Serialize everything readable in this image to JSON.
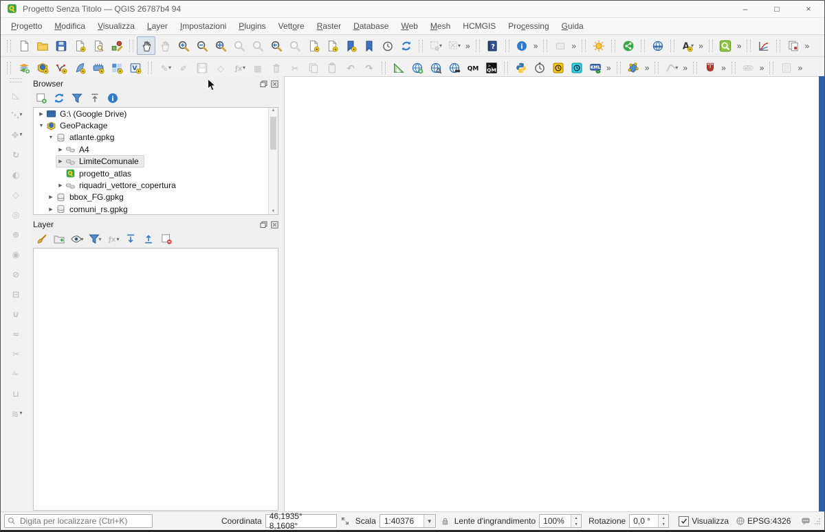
{
  "window": {
    "title": "Progetto Senza Titolo — QGIS 26787b4 94",
    "controls": {
      "minimize": "–",
      "maximize": "□",
      "close": "×"
    }
  },
  "menu": {
    "items": [
      {
        "label": "Progetto",
        "accel": 0
      },
      {
        "label": "Modifica",
        "accel": 0
      },
      {
        "label": "Visualizza",
        "accel": 0
      },
      {
        "label": "Layer",
        "accel": 0
      },
      {
        "label": "Impostazioni",
        "accel": 0
      },
      {
        "label": "Plugins",
        "accel": 0
      },
      {
        "label": "Vettore",
        "accel": 4
      },
      {
        "label": "Raster",
        "accel": 0
      },
      {
        "label": "Database",
        "accel": 0
      },
      {
        "label": "Web",
        "accel": 0
      },
      {
        "label": "Mesh",
        "accel": 0
      },
      {
        "label": "HCMGIS",
        "accel": -1
      },
      {
        "label": "Processing",
        "accel": 3
      },
      {
        "label": "Guida",
        "accel": 0
      }
    ]
  },
  "toolbar_row1": [
    {
      "sep": 1
    },
    {
      "n": "project-new",
      "k": "page"
    },
    {
      "n": "project-open",
      "k": "folder"
    },
    {
      "n": "project-save",
      "k": "floppy"
    },
    {
      "n": "new-print-layout",
      "k": "pagebadge"
    },
    {
      "n": "show-layout-manager",
      "k": "layoutmgr"
    },
    {
      "n": "style-manager",
      "k": "styles"
    },
    {
      "sep": 1
    },
    {
      "n": "pan-map",
      "k": "hand",
      "s": "active"
    },
    {
      "n": "pan-to-selection",
      "k": "handgray",
      "s": "disabled"
    },
    {
      "n": "zoom-in",
      "k": "magp"
    },
    {
      "n": "zoom-out",
      "k": "magm"
    },
    {
      "n": "zoom-full-extent",
      "k": "magfull"
    },
    {
      "n": "zoom-to-selection",
      "k": "maggray",
      "s": "disabled"
    },
    {
      "n": "zoom-to-layer",
      "k": "maggray",
      "s": "disabled"
    },
    {
      "n": "zoom-last",
      "k": "maglast"
    },
    {
      "n": "zoom-next",
      "k": "magnext",
      "s": "disabled"
    },
    {
      "n": "new-map-view",
      "k": "pagebadge"
    },
    {
      "n": "new-3d-map-view",
      "k": "pagebadge"
    },
    {
      "n": "new-spatial-bookmark",
      "k": "bmbadge"
    },
    {
      "n": "show-spatial-bookmarks",
      "k": "bookmark"
    },
    {
      "n": "temporal-controller",
      "k": "clock"
    },
    {
      "n": "refresh-map",
      "k": "refresh"
    },
    {
      "sep": 1
    },
    {
      "n": "select-features",
      "k": "selgray",
      "s": "disabled",
      "dd": 1
    },
    {
      "n": "deselect-features",
      "k": "deselgray",
      "s": "disabled",
      "dd": 1
    },
    {
      "ovf": 1
    },
    {
      "sep": 1
    },
    {
      "n": "help-contents",
      "k": "book"
    },
    {
      "sep": 1
    },
    {
      "n": "identify-info",
      "k": "info"
    },
    {
      "ovf": 1
    },
    {
      "sep": 1
    },
    {
      "n": "plugin-tool-disabled",
      "k": "gray1",
      "s": "disabled"
    },
    {
      "ovf": 1
    },
    {
      "sep": 1
    },
    {
      "n": "plugin-sun",
      "k": "sun"
    },
    {
      "sep": 1
    },
    {
      "n": "plugin-share",
      "k": "share"
    },
    {
      "sep": 1
    },
    {
      "n": "plugin-web-globe",
      "k": "globe"
    },
    {
      "sep": 1
    },
    {
      "n": "auto-label",
      "k": "labelA",
      "dd": 1
    },
    {
      "ovf": 1
    },
    {
      "sep": 1
    },
    {
      "n": "plugin-zoom-level",
      "k": "greenzoom"
    },
    {
      "ovf": 1
    },
    {
      "sep": 1
    },
    {
      "n": "plugin-profile-chart",
      "k": "chart"
    },
    {
      "sep": 1
    },
    {
      "n": "plugin-document-copy",
      "k": "doccopy"
    },
    {
      "ovf": 1
    }
  ],
  "toolbar_row2": [
    {
      "sep": 1
    },
    {
      "n": "data-source-manager",
      "k": "dsm"
    },
    {
      "n": "new-geopackage-layer",
      "k": "boxglobe"
    },
    {
      "n": "new-shapefile-layer",
      "k": "vnode"
    },
    {
      "n": "new-spatialite-layer",
      "k": "quill"
    },
    {
      "n": "new-temporary-scratch-layer",
      "k": "comb"
    },
    {
      "n": "new-mesh-layer",
      "k": "gridb"
    },
    {
      "n": "new-virtual-layer",
      "k": "vbox"
    },
    {
      "sep": 1
    },
    {
      "n": "current-edits",
      "k": "pengray",
      "s": "disabled",
      "dd": 1
    },
    {
      "n": "toggle-editing",
      "k": "pen2gray",
      "s": "disabled"
    },
    {
      "n": "save-layer-edits",
      "k": "floppygray",
      "s": "disabled"
    },
    {
      "n": "add-feature",
      "k": "polygray",
      "s": "disabled"
    },
    {
      "n": "field-calculator",
      "k": "fxgray",
      "s": "disabled",
      "dd": 1
    },
    {
      "n": "multiedit-attributes",
      "k": "tablegray",
      "s": "disabled"
    },
    {
      "n": "delete-selected",
      "k": "trash",
      "s": "disabled"
    },
    {
      "n": "cut-features",
      "k": "cut",
      "s": "disabled"
    },
    {
      "n": "copy-features",
      "k": "copygray",
      "s": "disabled"
    },
    {
      "n": "paste-features",
      "k": "paste",
      "s": "disabled"
    },
    {
      "n": "undo",
      "k": "undo",
      "s": "disabled"
    },
    {
      "n": "redo",
      "k": "redo",
      "s": "disabled"
    },
    {
      "sep": 1
    },
    {
      "n": "plugin-set-square",
      "k": "setsquare"
    },
    {
      "n": "plugin-globe-add",
      "k": "globeplus"
    },
    {
      "n": "plugin-globe-search",
      "k": "globemag"
    },
    {
      "n": "plugin-globe-binoculars",
      "k": "globebinoc"
    },
    {
      "n": "quickmapservices",
      "k": "qm"
    },
    {
      "n": "qms-search",
      "k": "qmb"
    },
    {
      "sep": 1
    },
    {
      "n": "python-console",
      "k": "python"
    },
    {
      "n": "plugin-stopwatch",
      "k": "stopwatch"
    },
    {
      "n": "plugin-time-manager",
      "k": "tyellow"
    },
    {
      "n": "plugin-temporal-cyan",
      "k": "tcyan"
    },
    {
      "n": "plugin-kml-tools",
      "k": "kml"
    },
    {
      "ovf": 1
    },
    {
      "sep": 1
    },
    {
      "n": "plugin-vertex-tool",
      "k": "vertexblue"
    },
    {
      "ovf": 1
    },
    {
      "sep": 1
    },
    {
      "n": "digitize-curve",
      "k": "curvegray",
      "s": "disabled",
      "dd": 1
    },
    {
      "ovf": 1
    },
    {
      "sep": 1
    },
    {
      "n": "snapping-toggle",
      "k": "magnet"
    },
    {
      "ovf": 1
    },
    {
      "sep": 1
    },
    {
      "n": "label-abc",
      "k": "abcgray",
      "s": "disabled"
    },
    {
      "ovf": 1
    },
    {
      "sep": 1
    },
    {
      "n": "layer-notes",
      "k": "notesgray",
      "s": "disabled"
    },
    {
      "ovf": 1
    }
  ],
  "left_toolbar": [
    {
      "handle": 1
    },
    {
      "n": "interpolate-point",
      "k": "g",
      "c": "◺"
    },
    {
      "n": "measure-segment",
      "k": "g",
      "c": "⋱",
      "dd": 1
    },
    {
      "n": "move-feature",
      "k": "g",
      "c": "✥",
      "dd": 1
    },
    {
      "n": "copy-move-feature",
      "k": "g",
      "c": "↻"
    },
    {
      "n": "rotate-feature",
      "k": "g",
      "c": "◐"
    },
    {
      "n": "simplify-feature",
      "k": "g",
      "c": "◇"
    },
    {
      "n": "add-ring",
      "k": "g",
      "c": "◎"
    },
    {
      "n": "add-part",
      "k": "g",
      "c": "⊕"
    },
    {
      "n": "fill-ring",
      "k": "g",
      "c": "◉"
    },
    {
      "n": "delete-ring",
      "k": "g",
      "c": "⊘"
    },
    {
      "n": "delete-part",
      "k": "g",
      "c": "⊟"
    },
    {
      "n": "offset-curve",
      "k": "g",
      "c": "∪"
    },
    {
      "n": "reshape-features",
      "k": "g",
      "c": "≈"
    },
    {
      "n": "split-features",
      "k": "g",
      "c": "✂"
    },
    {
      "n": "split-parts",
      "k": "g",
      "c": "✁"
    },
    {
      "n": "merge-features",
      "k": "g",
      "c": "⊔"
    },
    {
      "n": "trim-extend",
      "k": "g",
      "c": "≋",
      "dd": 1
    }
  ],
  "browser_panel": {
    "title": "Browser",
    "toolbar": [
      {
        "n": "add-selected-layers",
        "k": "boxplus"
      },
      {
        "n": "refresh-browser",
        "k": "refresh"
      },
      {
        "n": "filter-browser",
        "k": "funnel"
      },
      {
        "n": "collapse-all",
        "k": "collapseg"
      },
      {
        "n": "browser-properties",
        "k": "info"
      }
    ],
    "tree": [
      {
        "label": "G:\\ (Google Drive)",
        "depth": 0,
        "expand": "closed",
        "icon": "drive"
      },
      {
        "label": "GeoPackage",
        "depth": 0,
        "expand": "open",
        "icon": "gpkg"
      },
      {
        "label": "atlante.gpkg",
        "depth": 1,
        "expand": "open",
        "icon": "db"
      },
      {
        "label": "A4",
        "depth": 2,
        "expand": "closed",
        "icon": "poly"
      },
      {
        "label": "LimiteComunale",
        "depth": 2,
        "expand": "closed",
        "icon": "poly",
        "selected": true
      },
      {
        "label": "progetto_atlas",
        "depth": 2,
        "expand": "none",
        "icon": "qgis"
      },
      {
        "label": "riquadri_vettore_copertura",
        "depth": 2,
        "expand": "closed",
        "icon": "poly"
      },
      {
        "label": "bbox_FG.gpkg",
        "depth": 1,
        "expand": "closed",
        "icon": "db"
      },
      {
        "label": "comuni_rs.gpkg",
        "depth": 1,
        "expand": "closed",
        "icon": "db"
      }
    ]
  },
  "layers_panel": {
    "title": "Layer",
    "toolbar": [
      {
        "n": "open-layer-styling",
        "k": "brush"
      },
      {
        "n": "add-group",
        "k": "addgroup"
      },
      {
        "n": "manage-visibility",
        "k": "eye",
        "dd": 1
      },
      {
        "n": "filter-legend",
        "k": "funnel",
        "dd": 1
      },
      {
        "n": "filter-by-expression",
        "k": "fxgray",
        "s": "disabled",
        "dd": 1
      },
      {
        "n": "expand-all",
        "k": "expand"
      },
      {
        "n": "collapse-all-layers",
        "k": "collapse2"
      },
      {
        "n": "remove-layer",
        "k": "boxminus"
      }
    ]
  },
  "statusbar": {
    "locator_placeholder": "Digita per localizzare (Ctrl+K)",
    "coordinate_label": "Coordinata",
    "coordinate_value": "46,1935° 8,1608°",
    "scale_label": "Scala",
    "scale_value": "1:40376",
    "magnifier_label": "Lente d'ingrandimento",
    "magnifier_value": "100%",
    "rotation_label": "Rotazione",
    "rotation_value": "0,0 °",
    "render_label": "Visualizza",
    "render_checked": true,
    "crs_label": "EPSG:4326"
  },
  "colors": {
    "accent_blue": "#2d5fa6",
    "qgis_green": "#3aa648",
    "qgis_yellow": "#f5d327"
  }
}
